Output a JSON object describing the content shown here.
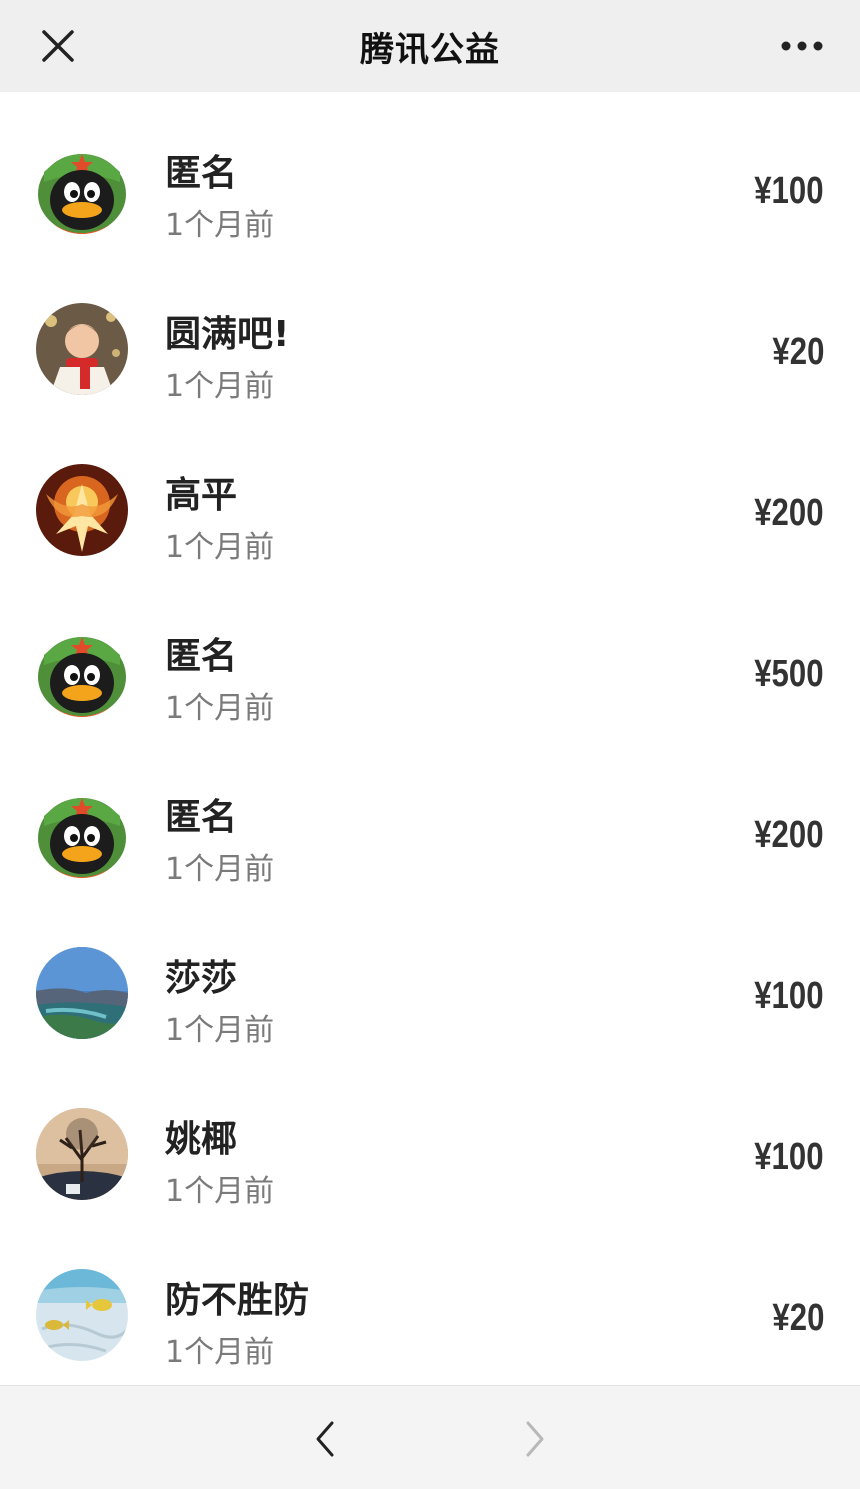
{
  "header": {
    "title": "腾讯公益"
  },
  "donations": [
    {
      "name": "匿名",
      "time": "1个月前",
      "amount": "¥100",
      "avatar": "penguin-avatar"
    },
    {
      "name": "圆满吧!",
      "time": "1个月前",
      "amount": "¥20",
      "avatar": "child-photo-avatar"
    },
    {
      "name": "高平",
      "time": "1个月前",
      "amount": "¥200",
      "avatar": "phoenix-fire-avatar"
    },
    {
      "name": "匿名",
      "time": "1个月前",
      "amount": "¥500",
      "avatar": "penguin-avatar"
    },
    {
      "name": "匿名",
      "time": "1个月前",
      "amount": "¥200",
      "avatar": "penguin-avatar"
    },
    {
      "name": "莎莎",
      "time": "1个月前",
      "amount": "¥100",
      "avatar": "landscape-avatar"
    },
    {
      "name": "姚椰",
      "time": "1个月前",
      "amount": "¥100",
      "avatar": "tree-avatar"
    },
    {
      "name": "防不胜防",
      "time": "1个月前",
      "amount": "¥20",
      "avatar": "fish-avatar"
    }
  ],
  "colors": {
    "header_bg": "#efefef",
    "footer_bg": "#f4f4f4",
    "amount": "#333333",
    "time": "#7a7a7a"
  }
}
